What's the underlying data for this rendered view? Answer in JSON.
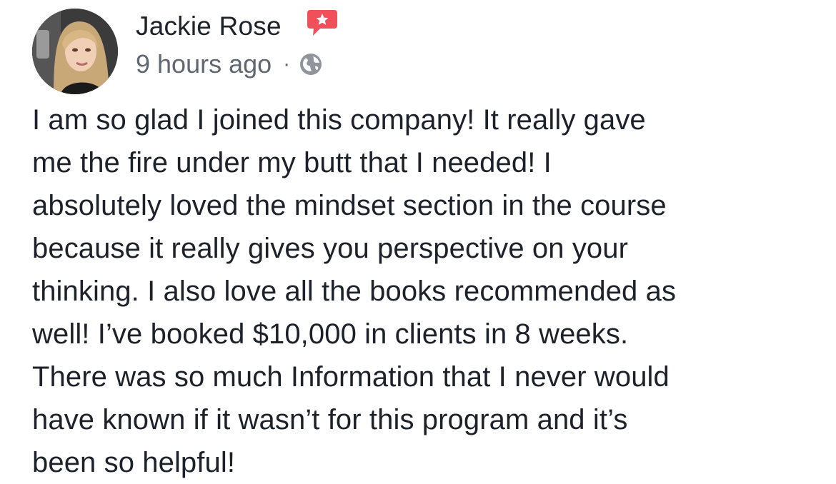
{
  "post": {
    "author": {
      "name": "Jackie Rose",
      "avatar_icon": "profile-photo",
      "badge_icon": "star-badge-icon",
      "badge_color": "#f0505a"
    },
    "meta": {
      "timestamp": "9 hours ago",
      "separator": "·",
      "privacy_icon": "globe-icon"
    },
    "body_lines": [
      "I am so glad I joined this company! It really gave",
      "me the fire under my butt that I needed! I",
      "absolutely loved the mindset section in the course",
      "because it really gives you perspective on your",
      "thinking. I also love all the books recommended as",
      "well! I’ve booked $10,000 in clients in 8 weeks.",
      "There was so much Information that I never would",
      "have known if it wasn’t for this program and it’s",
      "been so helpful!"
    ]
  }
}
